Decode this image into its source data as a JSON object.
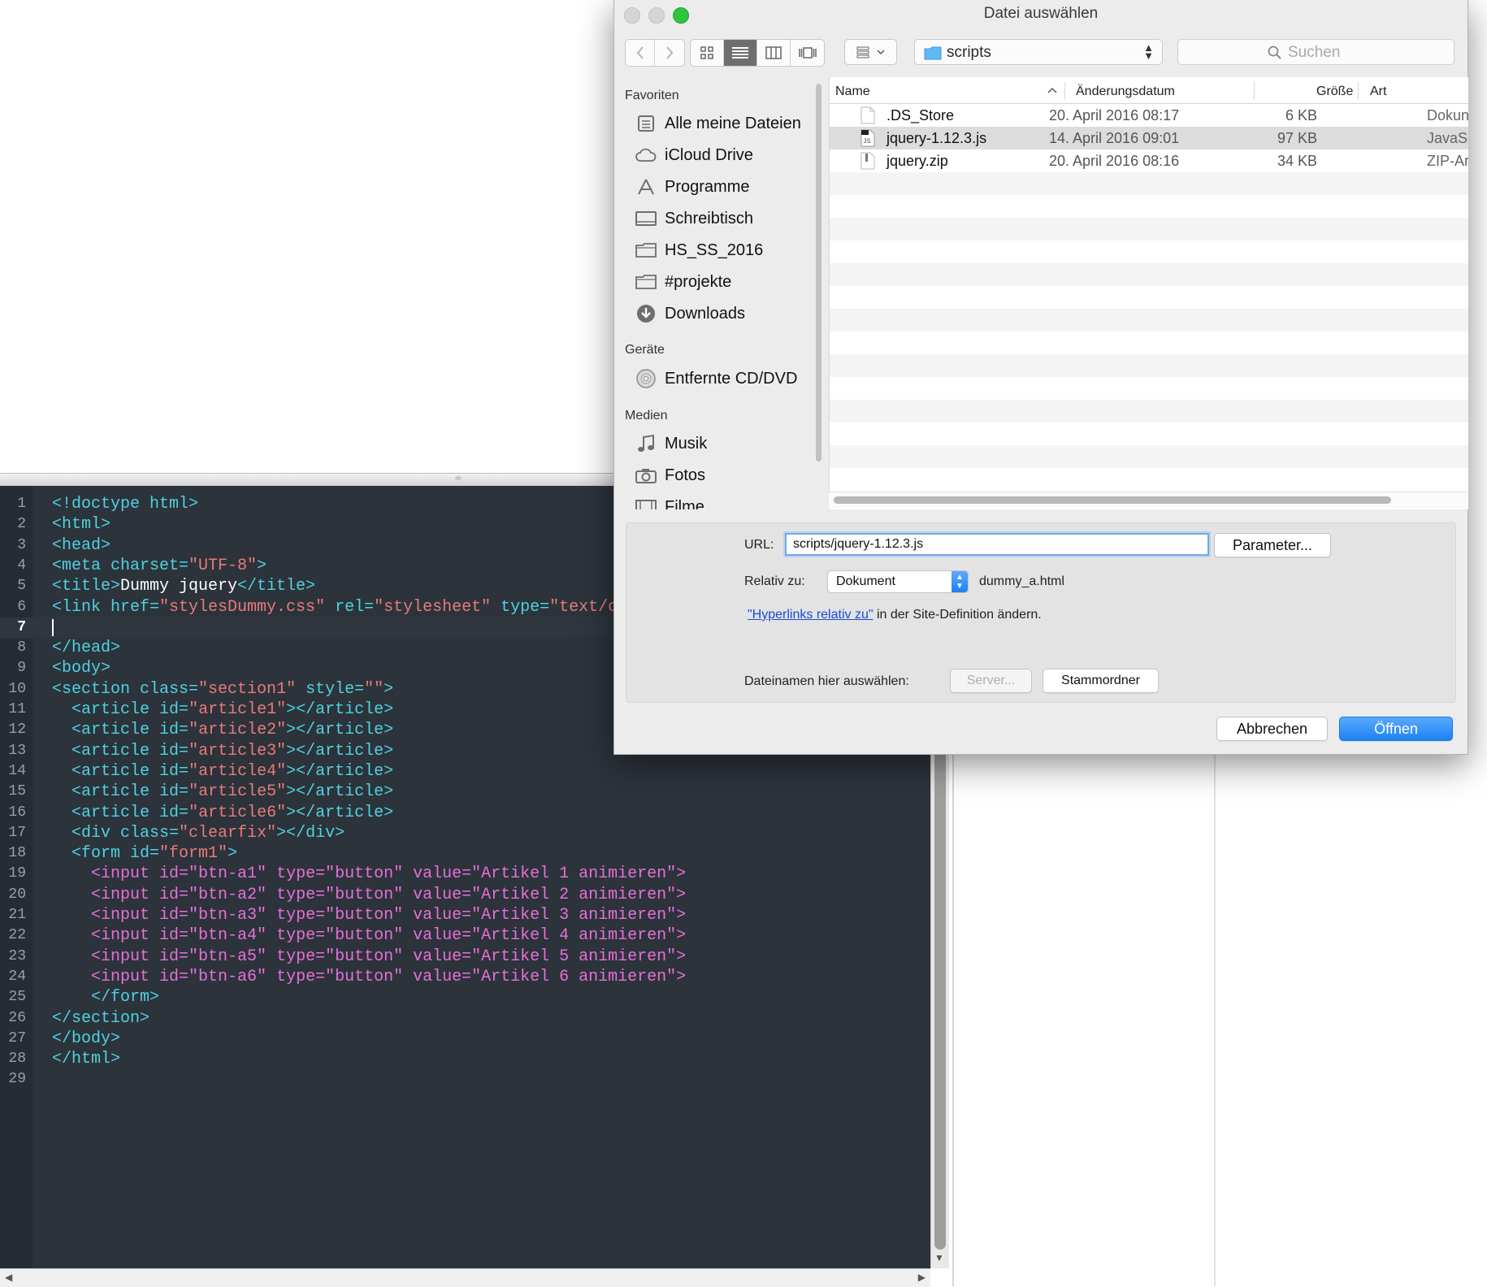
{
  "editor": {
    "current_line": 7,
    "lines": [
      {
        "n": "1",
        "segs": [
          [
            "tag",
            "<!doctype html>"
          ]
        ]
      },
      {
        "n": "2",
        "segs": [
          [
            "tag",
            "<html>"
          ]
        ]
      },
      {
        "n": "3",
        "segs": [
          [
            "tag",
            "<head>"
          ]
        ]
      },
      {
        "n": "4",
        "segs": [
          [
            "tag",
            "<meta "
          ],
          [
            "attr",
            "charset="
          ],
          [
            "str",
            "\"UTF-8\""
          ],
          [
            "tag",
            ">"
          ]
        ]
      },
      {
        "n": "5",
        "segs": [
          [
            "tag",
            "<title>"
          ],
          [
            "txt",
            "Dummy jquery"
          ],
          [
            "tag",
            "</title>"
          ]
        ]
      },
      {
        "n": "6",
        "segs": [
          [
            "tag",
            "<link "
          ],
          [
            "attr",
            "href="
          ],
          [
            "str",
            "\"stylesDummy.css\""
          ],
          [
            "attr",
            " rel="
          ],
          [
            "str",
            "\"stylesheet\""
          ],
          [
            "attr",
            " type="
          ],
          [
            "str",
            "\"text/css"
          ]
        ]
      },
      {
        "n": "7",
        "segs": []
      },
      {
        "n": "8",
        "segs": [
          [
            "tag",
            "</head>"
          ]
        ]
      },
      {
        "n": "9",
        "segs": [
          [
            "tag",
            "<body>"
          ]
        ]
      },
      {
        "n": "10",
        "segs": [
          [
            "tag",
            "<section "
          ],
          [
            "attr",
            "class="
          ],
          [
            "str",
            "\"section1\""
          ],
          [
            "attr",
            " style="
          ],
          [
            "str",
            "\"\""
          ],
          [
            "tag",
            ">"
          ]
        ]
      },
      {
        "n": "11",
        "segs": [
          [
            "txt",
            "  "
          ],
          [
            "tag",
            "<article "
          ],
          [
            "attr",
            "id="
          ],
          [
            "str",
            "\"article1\""
          ],
          [
            "tag",
            "></article>"
          ]
        ]
      },
      {
        "n": "12",
        "segs": [
          [
            "txt",
            "  "
          ],
          [
            "tag",
            "<article "
          ],
          [
            "attr",
            "id="
          ],
          [
            "str",
            "\"article2\""
          ],
          [
            "tag",
            "></article>"
          ]
        ]
      },
      {
        "n": "13",
        "segs": [
          [
            "txt",
            "  "
          ],
          [
            "tag",
            "<article "
          ],
          [
            "attr",
            "id="
          ],
          [
            "str",
            "\"article3\""
          ],
          [
            "tag",
            "></article>"
          ]
        ]
      },
      {
        "n": "14",
        "segs": [
          [
            "txt",
            "  "
          ],
          [
            "tag",
            "<article "
          ],
          [
            "attr",
            "id="
          ],
          [
            "str",
            "\"article4\""
          ],
          [
            "tag",
            "></article>"
          ]
        ]
      },
      {
        "n": "15",
        "segs": [
          [
            "txt",
            "  "
          ],
          [
            "tag",
            "<article "
          ],
          [
            "attr",
            "id="
          ],
          [
            "str",
            "\"article5\""
          ],
          [
            "tag",
            "></article>"
          ]
        ]
      },
      {
        "n": "16",
        "segs": [
          [
            "txt",
            "  "
          ],
          [
            "tag",
            "<article "
          ],
          [
            "attr",
            "id="
          ],
          [
            "str",
            "\"article6\""
          ],
          [
            "tag",
            "></article>"
          ]
        ]
      },
      {
        "n": "17",
        "segs": [
          [
            "txt",
            "  "
          ],
          [
            "tag",
            "<div "
          ],
          [
            "attr",
            "class="
          ],
          [
            "str",
            "\"clearfix\""
          ],
          [
            "tag",
            "></div>"
          ]
        ]
      },
      {
        "n": "18",
        "segs": [
          [
            "txt",
            "  "
          ],
          [
            "tag",
            "<form "
          ],
          [
            "attr",
            "id="
          ],
          [
            "str",
            "\"form1\""
          ],
          [
            "tag",
            ">"
          ]
        ]
      },
      {
        "n": "19",
        "segs": [
          [
            "txt",
            "    "
          ],
          [
            "itag",
            "<input "
          ],
          [
            "iattr",
            "id="
          ],
          [
            "istr",
            "\"btn-a1\""
          ],
          [
            "iattr",
            " type="
          ],
          [
            "istr",
            "\"button\""
          ],
          [
            "iattr",
            " value="
          ],
          [
            "istr",
            "\"Artikel 1 animieren\""
          ],
          [
            "itag",
            ">"
          ]
        ]
      },
      {
        "n": "20",
        "segs": [
          [
            "txt",
            "    "
          ],
          [
            "itag",
            "<input "
          ],
          [
            "iattr",
            "id="
          ],
          [
            "istr",
            "\"btn-a2\""
          ],
          [
            "iattr",
            " type="
          ],
          [
            "istr",
            "\"button\""
          ],
          [
            "iattr",
            " value="
          ],
          [
            "istr",
            "\"Artikel 2 animieren\""
          ],
          [
            "itag",
            ">"
          ]
        ]
      },
      {
        "n": "21",
        "segs": [
          [
            "txt",
            "    "
          ],
          [
            "itag",
            "<input "
          ],
          [
            "iattr",
            "id="
          ],
          [
            "istr",
            "\"btn-a3\""
          ],
          [
            "iattr",
            " type="
          ],
          [
            "istr",
            "\"button\""
          ],
          [
            "iattr",
            " value="
          ],
          [
            "istr",
            "\"Artikel 3 animieren\""
          ],
          [
            "itag",
            ">"
          ]
        ]
      },
      {
        "n": "22",
        "segs": [
          [
            "txt",
            "    "
          ],
          [
            "itag",
            "<input "
          ],
          [
            "iattr",
            "id="
          ],
          [
            "istr",
            "\"btn-a4\""
          ],
          [
            "iattr",
            " type="
          ],
          [
            "istr",
            "\"button\""
          ],
          [
            "iattr",
            " value="
          ],
          [
            "istr",
            "\"Artikel 4 animieren\""
          ],
          [
            "itag",
            ">"
          ]
        ]
      },
      {
        "n": "23",
        "segs": [
          [
            "txt",
            "    "
          ],
          [
            "itag",
            "<input "
          ],
          [
            "iattr",
            "id="
          ],
          [
            "istr",
            "\"btn-a5\""
          ],
          [
            "iattr",
            " type="
          ],
          [
            "istr",
            "\"button\""
          ],
          [
            "iattr",
            " value="
          ],
          [
            "istr",
            "\"Artikel 5 animieren\""
          ],
          [
            "itag",
            ">"
          ]
        ]
      },
      {
        "n": "24",
        "segs": [
          [
            "txt",
            "    "
          ],
          [
            "itag",
            "<input "
          ],
          [
            "iattr",
            "id="
          ],
          [
            "istr",
            "\"btn-a6\""
          ],
          [
            "iattr",
            " type="
          ],
          [
            "istr",
            "\"button\""
          ],
          [
            "iattr",
            " value="
          ],
          [
            "istr",
            "\"Artikel 6 animieren\""
          ],
          [
            "itag",
            ">"
          ]
        ]
      },
      {
        "n": "25",
        "segs": [
          [
            "txt",
            "    "
          ],
          [
            "tag",
            "</form>"
          ]
        ]
      },
      {
        "n": "26",
        "segs": [
          [
            "tag",
            "</section>"
          ]
        ]
      },
      {
        "n": "27",
        "segs": [
          [
            "tag",
            "</body>"
          ]
        ]
      },
      {
        "n": "28",
        "segs": [
          [
            "tag",
            "</html>"
          ]
        ]
      },
      {
        "n": "29",
        "segs": []
      }
    ],
    "colors": {
      "background": "#2c333b",
      "tag": "#4fd2e0",
      "string": "#e97a7a",
      "input_markup": "#e76fd8"
    }
  },
  "dialog": {
    "title": "Datei auswählen",
    "path_popup": "scripts",
    "search_placeholder": "Suchen",
    "sidebar": {
      "sections": [
        {
          "heading": "Favoriten",
          "items": [
            {
              "label": "Alle meine Dateien",
              "icon": "all-files-icon"
            },
            {
              "label": "iCloud Drive",
              "icon": "cloud-icon"
            },
            {
              "label": "Programme",
              "icon": "applications-icon"
            },
            {
              "label": "Schreibtisch",
              "icon": "desktop-icon"
            },
            {
              "label": "HS_SS_2016",
              "icon": "folder-icon"
            },
            {
              "label": "#projekte",
              "icon": "folder-icon"
            },
            {
              "label": "Downloads",
              "icon": "downloads-icon"
            }
          ]
        },
        {
          "heading": "Geräte",
          "items": [
            {
              "label": "Entfernte CD/DVD",
              "icon": "disc-icon"
            }
          ]
        },
        {
          "heading": "Medien",
          "items": [
            {
              "label": "Musik",
              "icon": "music-icon"
            },
            {
              "label": "Fotos",
              "icon": "camera-icon"
            },
            {
              "label": "Filme",
              "icon": "film-icon"
            }
          ]
        }
      ]
    },
    "columns": {
      "name": "Name",
      "date": "Änderungsdatum",
      "size": "Größe",
      "kind": "Art"
    },
    "files": [
      {
        "name": ".DS_Store",
        "date": "20. April 2016 08:17",
        "size": "6 KB",
        "kind": "Dokun",
        "icon": "document-icon",
        "selected": false
      },
      {
        "name": "jquery-1.12.3.js",
        "date": "14. April 2016 09:01",
        "size": "97 KB",
        "kind": "JavaSc",
        "icon": "script-file-icon",
        "selected": true
      },
      {
        "name": "jquery.zip",
        "date": "20. April 2016 08:16",
        "size": "34 KB",
        "kind": "ZIP-Ar",
        "icon": "zip-file-icon",
        "selected": false
      }
    ],
    "options": {
      "url_label": "URL:",
      "url_value": "scripts/jquery-1.12.3.js",
      "parameter_button": "Parameter...",
      "relative_label": "Relativ zu:",
      "relative_value": "Dokument",
      "relative_file": "dummy_a.html",
      "hyperlink_link": "\"Hyperlinks relativ zu\"",
      "hyperlink_rest": " in der Site-Definition ändern.",
      "filenames_label": "Dateinamen hier auswählen:",
      "server_button": "Server...",
      "root_button": "Stammordner"
    },
    "cancel_button": "Abbrechen",
    "open_button": "Öffnen"
  }
}
